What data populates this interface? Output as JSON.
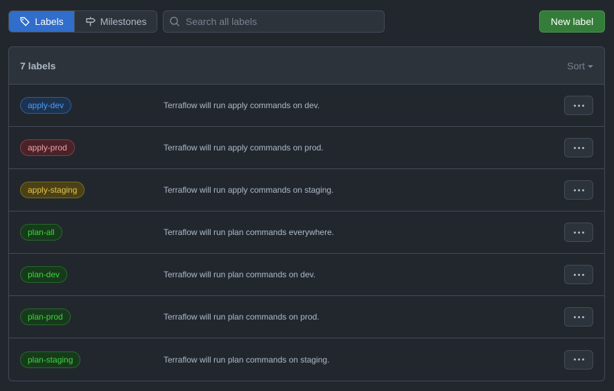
{
  "tabs": [
    {
      "label": "Labels",
      "icon": "tag-icon",
      "active": true
    },
    {
      "label": "Milestones",
      "icon": "milestone-icon",
      "active": false
    }
  ],
  "search": {
    "placeholder": "Search all labels",
    "value": ""
  },
  "new_label_button": "New label",
  "header": {
    "count": "7 labels",
    "sort": "Sort"
  },
  "labels": [
    {
      "name": "apply-dev",
      "description": "Terraflow will run apply commands on dev.",
      "color": "#539bf5",
      "bg": "#1c3350",
      "border": "#2f5e94"
    },
    {
      "name": "apply-prod",
      "description": "Terraflow will run apply commands on prod.",
      "color": "#f0a0a6",
      "bg": "#4a2329",
      "border": "#8a3b44"
    },
    {
      "name": "apply-staging",
      "description": "Terraflow will run apply commands on staging.",
      "color": "#e6c54a",
      "bg": "#4a4116",
      "border": "#7c6b1f"
    },
    {
      "name": "plan-all",
      "description": "Terraflow will run plan commands everywhere.",
      "color": "#3ed43e",
      "bg": "#173a1c",
      "border": "#256a2b"
    },
    {
      "name": "plan-dev",
      "description": "Terraflow will run plan commands on dev.",
      "color": "#3ed43e",
      "bg": "#173a1c",
      "border": "#256a2b"
    },
    {
      "name": "plan-prod",
      "description": "Terraflow will run plan commands on prod.",
      "color": "#3ed43e",
      "bg": "#173a1c",
      "border": "#256a2b"
    },
    {
      "name": "plan-staging",
      "description": "Terraflow will run plan commands on staging.",
      "color": "#3ed43e",
      "bg": "#173a1c",
      "border": "#256a2b"
    }
  ],
  "row_action_icon": "kebab-horizontal-icon"
}
